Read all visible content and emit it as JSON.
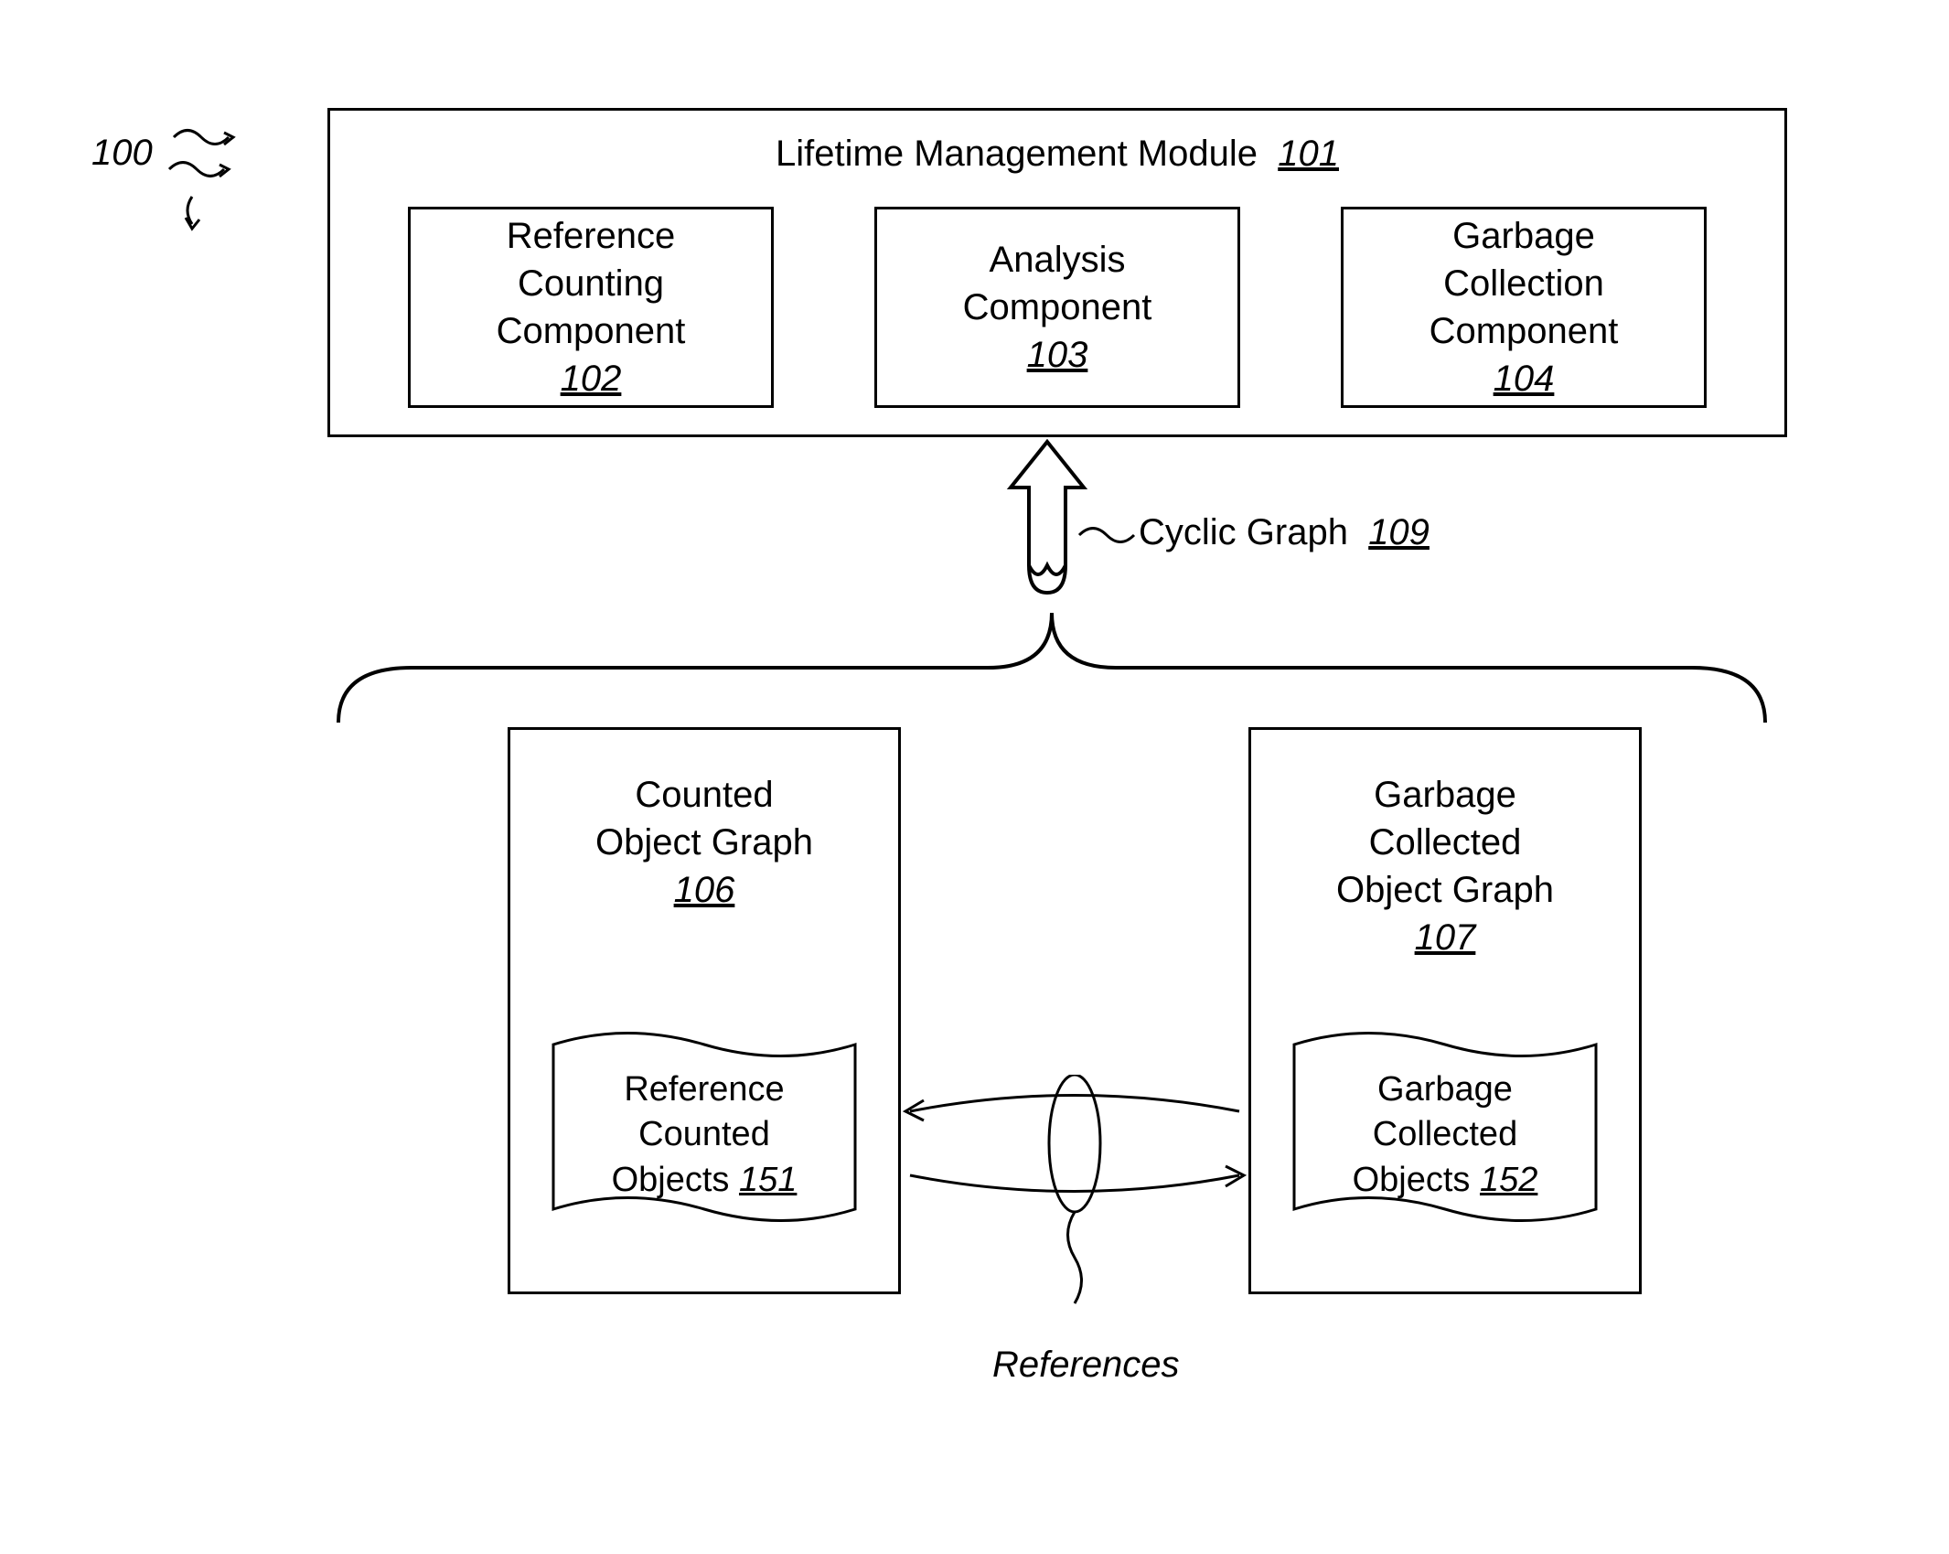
{
  "figure": {
    "label": "100"
  },
  "module": {
    "title_text": "Lifetime Management Module",
    "title_num": "101",
    "components": [
      {
        "line1": "Reference",
        "line2": "Counting",
        "line3": "Component",
        "num": "102"
      },
      {
        "line1": "Analysis",
        "line2": "Component",
        "line3": "",
        "num": "103"
      },
      {
        "line1": "Garbage",
        "line2": "Collection",
        "line3": "Component",
        "num": "104"
      }
    ]
  },
  "cyclic": {
    "label": "Cyclic Graph",
    "num": "109"
  },
  "graphs": {
    "left": {
      "title_l1": "Counted",
      "title_l2": "Object Graph",
      "num": "106",
      "doc_l1": "Reference",
      "doc_l2": "Counted",
      "doc_l3": "Objects",
      "doc_num": "151"
    },
    "right": {
      "title_l1": "Garbage",
      "title_l2": "Collected",
      "title_l3": "Object Graph",
      "num": "107",
      "doc_l1": "Garbage",
      "doc_l2": "Collected",
      "doc_l3": "Objects",
      "doc_num": "152"
    }
  },
  "references_label": "References"
}
